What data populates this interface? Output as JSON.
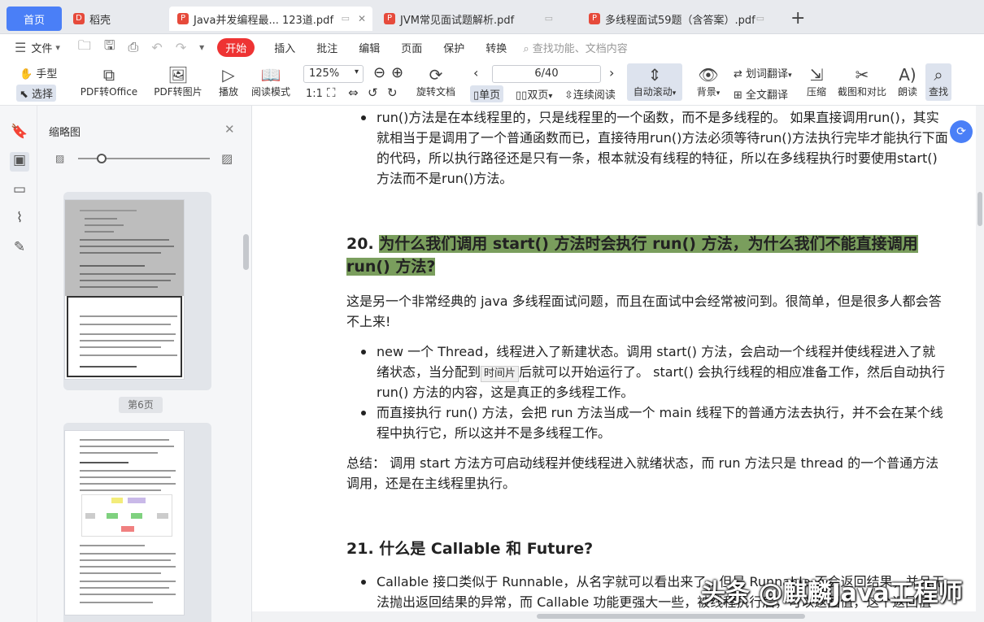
{
  "tabs": {
    "home": "首页",
    "daoke": "稻壳",
    "pdf1": "Java并发编程最... 123道.pdf",
    "pdf2": "JVM常见面试题解析.pdf",
    "pdf3": "多线程面试59题（含答案）.pdf",
    "plus": "+",
    "close": "✕"
  },
  "menu": {
    "file": "文件",
    "start": "开始",
    "insert": "插入",
    "annotate": "批注",
    "edit": "编辑",
    "page": "页面",
    "protect": "保护",
    "convert": "转换",
    "search_placeholder": "查找功能、文档内容"
  },
  "toolbar": {
    "hand": "手型",
    "select": "选择",
    "pdf_office": "PDF转Office",
    "pdf_image": "PDF转图片",
    "play": "播放",
    "read_mode": "阅读模式",
    "zoom": "125%",
    "rotate": "旋转文档",
    "page_display": "6/40",
    "single": "单页",
    "double": "双页",
    "continuous": "连续阅读",
    "auto_scroll": "自动滚动",
    "background": "背景",
    "word_translate": "划词翻译",
    "full_translate": "全文翻译",
    "compress": "压缩",
    "screenshot": "截图和对比",
    "read_aloud": "朗读",
    "find": "查找"
  },
  "sidebar": {
    "title": "缩略图",
    "page6": "第6页"
  },
  "doc": {
    "p1": "run()方法是在本线程里的，只是线程里的一个函数，而不是多线程的。 如果直接调用run()，其实就相当于是调用了一个普通函数而已，直接待用run()方法必须等待run()方法执行完毕才能执行下面的代码，所以执行路径还是只有一条，根本就没有线程的特征，所以在多线程执行时要使用start()方法而不是run()方法。",
    "h20num": "20. ",
    "h20": "为什么我们调用 start() 方法时会执行 run() 方法，为什么我们不能直接调用 run() 方法?",
    "p2": "这是另一个非常经典的 java 多线程面试问题，而且在面试中会经常被问到。很简单，但是很多人都会答不上来!",
    "b1a": "new 一个 Thread，线程进入了新建状态。调用 start() 方法，会启动一个线程并使线程进入了就绪状态，当分配到",
    "tooltip": "时间片",
    "b1b": "后就可以开始运行了。 start() 会执行线程的相应准备工作，然后自动执行 run() 方法的内容，这是真正的多线程工作。",
    "b2": "而直接执行 run() 方法，会把 run 方法当成一个 main 线程下的普通方法去执行，并不会在某个线程中执行它，所以这并不是多线程工作。",
    "summary": "总结： 调用 start 方法方可启动线程并使线程进入就绪状态，而 run 方法只是 thread 的一个普通方法调用，还是在主线程里执行。",
    "h21": "21. 什么是 Callable 和 Future?",
    "b3": "Callable 接口类似于 Runnable，从名字就可以看出来了，但是 Runnable 不会返回结果，并且无法抛出返回结果的异常，而 Callable 功能更强大一些，被线程执行后，可以返回值，这个返回值"
  },
  "watermark": "头条 @麒麟Java工程师",
  "colors": {
    "accent": "#4a7ff7",
    "start": "#e33333",
    "highlight": "#7a9e5d"
  }
}
